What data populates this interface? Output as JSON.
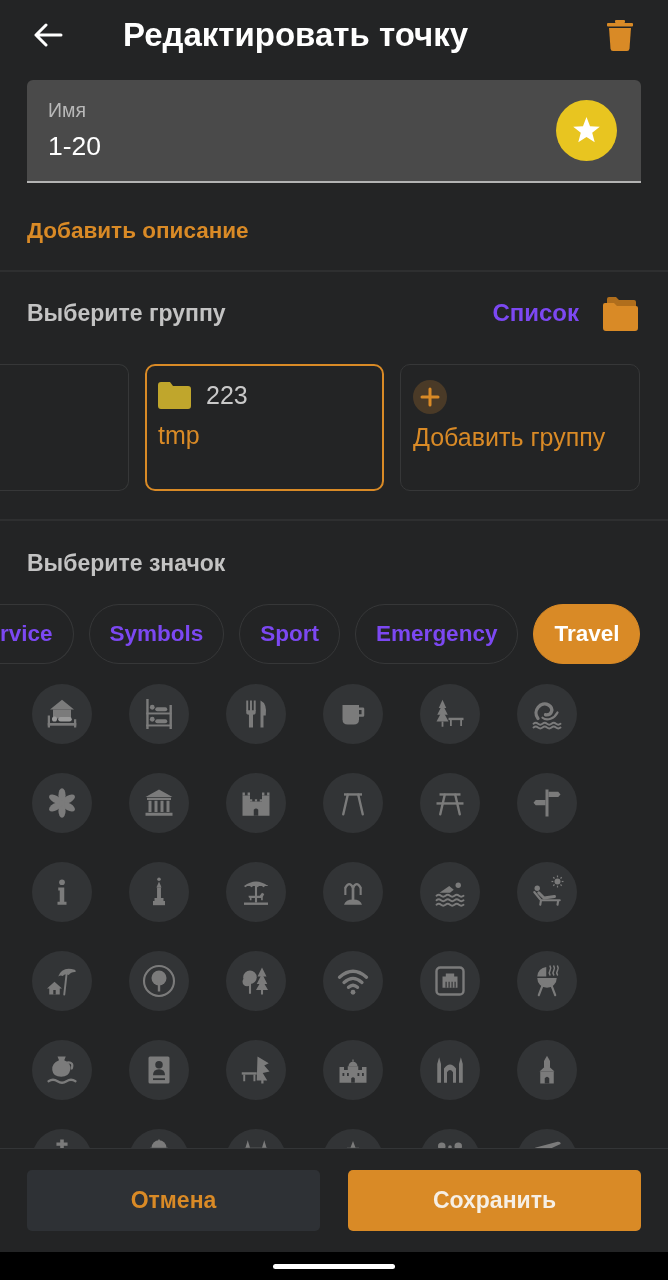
{
  "header": {
    "title": "Редактировать точку"
  },
  "name_field": {
    "label": "Имя",
    "value": "1-20"
  },
  "add_description": "Добавить описание",
  "group_section": {
    "title": "Выберите группу",
    "list_link": "Список"
  },
  "groups": [
    {
      "selected": false
    },
    {
      "count": "223",
      "name": "tmp",
      "color": "#c0a62c",
      "selected": true
    }
  ],
  "add_group": {
    "label": "Добавить группу"
  },
  "icon_section": {
    "title": "Выберите значок"
  },
  "categories": [
    {
      "label": "rvice",
      "selected": false
    },
    {
      "label": "Symbols",
      "selected": false
    },
    {
      "label": "Sport",
      "selected": false
    },
    {
      "label": "Emergency",
      "selected": false
    },
    {
      "label": "Travel",
      "selected": true
    }
  ],
  "icons": [
    {
      "kind": "bed_house"
    },
    {
      "kind": "bunk_bed"
    },
    {
      "kind": "fork_knife"
    },
    {
      "kind": "cup"
    },
    {
      "kind": "tree_bench"
    },
    {
      "kind": "slide"
    },
    {
      "kind": "flower"
    },
    {
      "kind": "columns"
    },
    {
      "kind": "castle"
    },
    {
      "kind": "a_frame"
    },
    {
      "kind": "picnic_table"
    },
    {
      "kind": "signpost"
    },
    {
      "kind": "info"
    },
    {
      "kind": "statue"
    },
    {
      "kind": "carousel"
    },
    {
      "kind": "fountain"
    },
    {
      "kind": "swimmer"
    },
    {
      "kind": "sunbather"
    },
    {
      "kind": "house_umbrella"
    },
    {
      "kind": "tree_circle"
    },
    {
      "kind": "trees"
    },
    {
      "kind": "wifi"
    },
    {
      "kind": "network_port"
    },
    {
      "kind": "grill"
    },
    {
      "kind": "jug"
    },
    {
      "kind": "portrait"
    },
    {
      "kind": "bench_tree"
    },
    {
      "kind": "palace"
    },
    {
      "kind": "spires"
    },
    {
      "kind": "chapel"
    },
    {
      "kind": "cross"
    },
    {
      "kind": "dome"
    },
    {
      "kind": "twin_spires"
    },
    {
      "kind": "spire"
    },
    {
      "kind": "domes"
    },
    {
      "kind": "plane"
    }
  ],
  "buttons": [
    {
      "label": "Отмена",
      "kind": "secondary"
    },
    {
      "label": "Сохранить",
      "kind": "primary"
    }
  ]
}
